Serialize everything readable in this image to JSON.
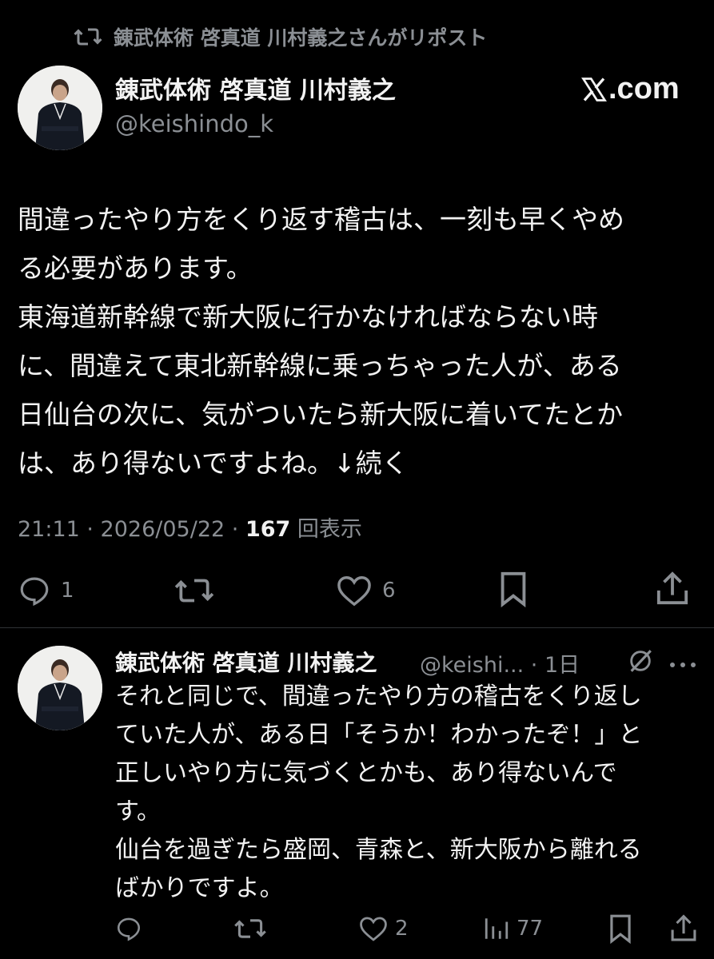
{
  "repost": {
    "text": "錬武体術 啓真道 川村義之さんがリポスト"
  },
  "author": {
    "name": "錬武体術 啓真道 川村義之",
    "handle": "@keishindo_k"
  },
  "brand": {
    "logo_text": ".com"
  },
  "tweet": {
    "lines": [
      "間違ったやり方をくり返す稽古は、一刻も早くやめ",
      "る必要があります。",
      "東海道新幹線で新大阪に行かなければならない時",
      "に、間違えて東北新幹線に乗っちゃった人が、ある",
      "日仙台の次に、気がついたら新大阪に着いてたとか",
      "は、あり得ないですよね。↓続く"
    ],
    "time": "21:11 · 2026/05/22 · ",
    "views": "167",
    "views_label": " 回表示",
    "actions": {
      "reply_count": "1",
      "repost_count": "",
      "like_count": "6"
    }
  },
  "reply": {
    "name": "錬武体術 啓真道 川村義之",
    "handle": "@keishi... · 1日",
    "lines": [
      "それと同じで、間違ったやり方の稽古をくり返し",
      "ていた人が、ある日「そうか！わかったぞ！」と",
      "正しいやり方に気づくとかも、あり得ないんで",
      "す。",
      "仙台を過ぎたら盛岡、青森と、新大阪から離れる",
      "ばかりですよ。"
    ],
    "actions": {
      "reply_count": "",
      "repost_count": "",
      "like_count": "2",
      "view_count": "77"
    }
  },
  "icons": {
    "repost": "repost-icon",
    "reply": "reply-icon",
    "like": "heart-icon",
    "bookmark": "bookmark-icon",
    "share": "share-icon",
    "views": "views-icon",
    "grok": "grok-icon",
    "more": "more-icon",
    "x": "x-logo-icon"
  },
  "colors": {
    "background": "#000000",
    "text": "#e7e9ea",
    "muted": "#8b8f94",
    "divider": "#2f3336"
  }
}
